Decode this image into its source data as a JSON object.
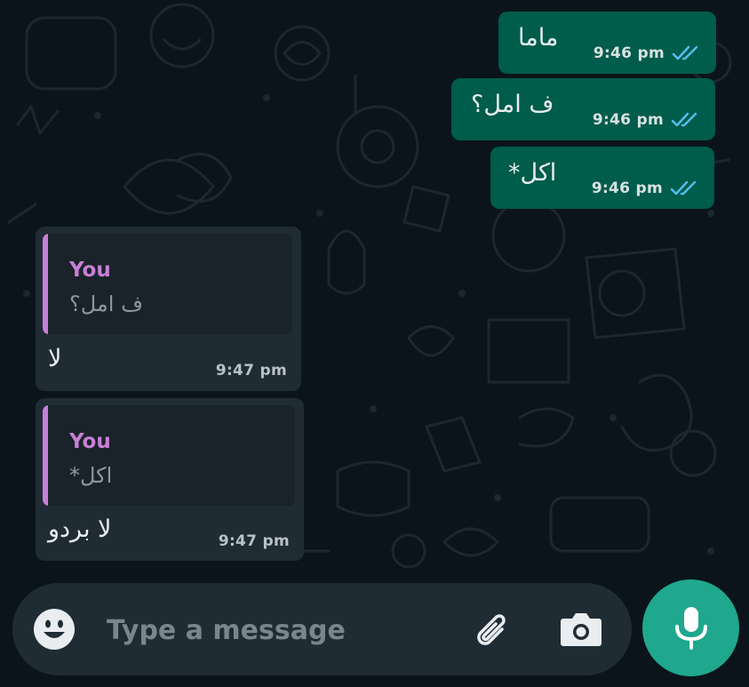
{
  "conversation": {
    "outgoing": [
      {
        "text": "ماما",
        "time": "9:46 pm",
        "status_icon": "double-check-read-icon"
      },
      {
        "text": "ف امل؟",
        "time": "9:46 pm",
        "status_icon": "double-check-read-icon"
      },
      {
        "text": "اكل*",
        "time": "9:46 pm",
        "status_icon": "double-check-read-icon"
      }
    ],
    "incoming": [
      {
        "quote_author": "You",
        "quote_text": "ف امل؟",
        "text": "لا",
        "time": "9:47 pm"
      },
      {
        "quote_author": "You",
        "quote_text": "اكل*",
        "text": "لا بردو",
        "time": "9:47 pm"
      }
    ]
  },
  "composer": {
    "placeholder": "Type a message",
    "emoji_icon": "emoji-icon",
    "attach_icon": "paperclip-icon",
    "camera_icon": "camera-icon",
    "mic_icon": "microphone-icon"
  },
  "colors": {
    "background": "#0b141a",
    "outgoing_bubble": "#005c4b",
    "incoming_bubble": "#1f2c34",
    "quote_accent": "#c87fd6",
    "read_ticks": "#53bdeb",
    "mic_button": "#1fa88e"
  }
}
